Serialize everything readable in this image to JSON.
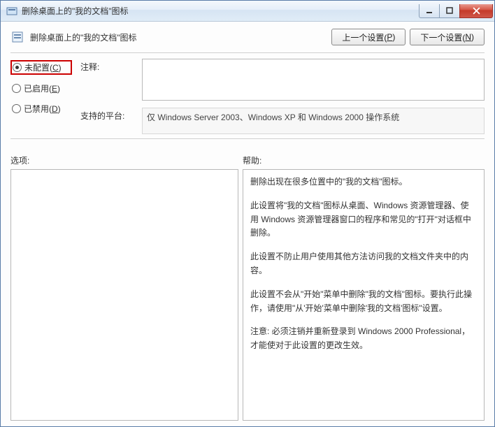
{
  "window": {
    "title": "删除桌面上的\"我的文档\"图标"
  },
  "winbtn": {
    "min": "minimize",
    "max": "maximize",
    "close": "close"
  },
  "header": {
    "policy_title": "删除桌面上的\"我的文档\"图标",
    "prev_label": "上一个设置(",
    "prev_key": "P",
    "prev_suffix": ")",
    "next_label": "下一个设置(",
    "next_key": "N",
    "next_suffix": ")"
  },
  "radios": {
    "not_configured": "未配置(",
    "not_configured_key": "C",
    "not_configured_suffix": ")",
    "enabled": "已启用(",
    "enabled_key": "E",
    "enabled_suffix": ")",
    "disabled": "已禁用(",
    "disabled_key": "D",
    "disabled_suffix": ")"
  },
  "fields": {
    "comment_label": "注释:",
    "comment_value": "",
    "supported_label": "支持的平台:",
    "supported_value": "仅 Windows Server 2003、Windows XP 和 Windows 2000 操作系统"
  },
  "sections": {
    "options_label": "选项:",
    "help_label": "帮助:"
  },
  "help": {
    "p1": "删除出现在很多位置中的\"我的文档\"图标。",
    "p2": "此设置将\"我的文档\"图标从桌面、Windows 资源管理器、使用 Windows 资源管理器窗口的程序和常见的\"打开\"对话框中删除。",
    "p3": "此设置不防止用户使用其他方法访问我的文档文件夹中的内容。",
    "p4": "此设置不会从\"开始\"菜单中删除\"我的文档\"图标。要执行此操作，请使用\"从'开始'菜单中删除'我的文档'图标\"设置。",
    "p5": "注意: 必须注销并重新登录到 Windows 2000 Professional，才能使对于此设置的更改生效。"
  }
}
